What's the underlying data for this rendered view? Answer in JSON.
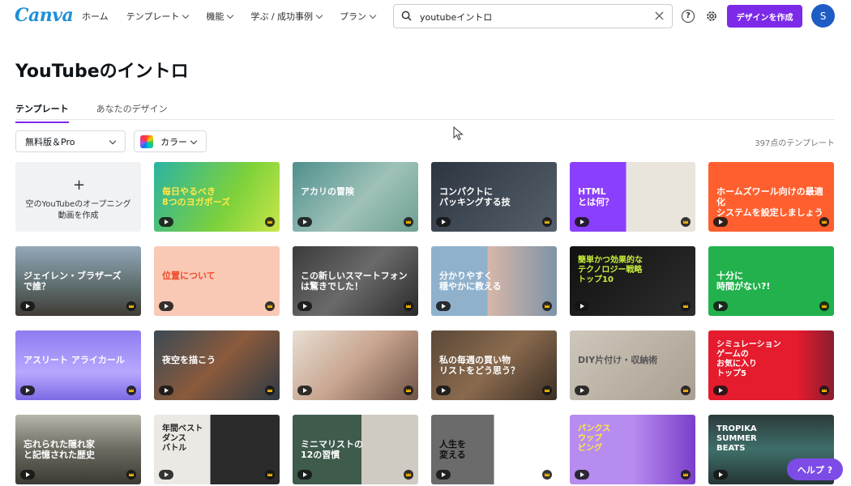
{
  "logo": "Canva",
  "nav": [
    {
      "label": "ホーム",
      "has_menu": false
    },
    {
      "label": "テンプレート",
      "has_menu": true
    },
    {
      "label": "機能",
      "has_menu": true
    },
    {
      "label": "学ぶ / 成功事例",
      "has_menu": true
    },
    {
      "label": "プラン",
      "has_menu": true
    }
  ],
  "search": {
    "value": "youtubeイントロ"
  },
  "header": {
    "create_label": "デザインを作成",
    "avatar_initial": "S"
  },
  "page": {
    "title": "YouTubeのイントロ"
  },
  "tabs": [
    {
      "label": "テンプレート",
      "active": true
    },
    {
      "label": "あなたのデザイン",
      "active": false
    }
  ],
  "filters": {
    "plan": "無料版＆Pro",
    "color": "カラー",
    "count": "397点のテンプレート"
  },
  "create_card": {
    "label": "空のYouTubeのオープニング動画を作成"
  },
  "cards": [
    {
      "text": "毎日やるべき\n8つのヨガポーズ",
      "bg": "linear-gradient(120deg,#2bb3a3,#7dd13a 60%,#c9e64a)",
      "color": "#ffe94a"
    },
    {
      "text": "アカリの冒険",
      "bg": "linear-gradient(135deg,#4e8f8d,#9fc2b8 55%,#6e9f93)",
      "color": "#ffffff"
    },
    {
      "text": "コンパクトに\nパッキングする技",
      "bg": "linear-gradient(135deg,#2c3540,#56606b)",
      "color": "#ffffff"
    },
    {
      "text": "HTML\nとは何？",
      "bg": "linear-gradient(90deg,#8a3ffc 45%,#e9e4dc 45%)",
      "color": "#ffffff"
    },
    {
      "text": "ホームズワール向けの最適化\nシステムを設定しましょう",
      "bg": "#ff5f2e",
      "color": "#ffffff"
    },
    {
      "text": "ジェイレン・ブラザーズ\nで誰？",
      "bg": "linear-gradient(180deg,#93a8b9,#5c6a6a 60%,#403c35)",
      "color": "#ffffff"
    },
    {
      "text": "位置について",
      "bg": "#f9c9b6",
      "color": "#ef4b2a"
    },
    {
      "text": "この新しいスマートフォン\nは驚きでした！",
      "bg": "linear-gradient(135deg,#3b3b3b,#6a6a6a 50%,#2a2a2a)",
      "color": "#ffffff"
    },
    {
      "text": "分かりやすく\n穏やかに教える",
      "bg": "linear-gradient(90deg,#8fb1cc 45%,#d7b7a8 45%,#7d93a8)",
      "color": "#ffffff"
    },
    {
      "text": "簡単かつ効果的な\nテクノロジー戦略\nトップ10",
      "bg": "linear-gradient(135deg,#111111,#2d2d2d)",
      "color": "#c9f03a"
    },
    {
      "text": "十分に\n時間がない?!",
      "bg": "#22b14c",
      "color": "#ffffff"
    },
    {
      "text": "アスリート  アライカール",
      "bg": "linear-gradient(180deg,#8d7cf0,#b9a8ff 60%,#7b69e3)",
      "color": "#ffffff"
    },
    {
      "text": "夜空を描こう",
      "bg": "linear-gradient(135deg,#3a4a55,#8b5a3c 50%,#2e3a44)",
      "color": "#ffffff"
    },
    {
      "text": "",
      "bg": "linear-gradient(135deg,#e8dfd4,#c7a38e 50%,#6e5346)",
      "color": "#ffffff"
    },
    {
      "text": "私の毎週の買い物\nリストをどう思う？",
      "bg": "linear-gradient(135deg,#5a4838,#8a6a4e 50%,#3b2f25)",
      "color": "#ffffff"
    },
    {
      "text": "DIY片付け・収納術",
      "bg": "linear-gradient(135deg,#cfc7bc,#a99f91)",
      "color": "#555555"
    },
    {
      "text": "シミュレーション\nゲームの\nお気に入り\nトップ5",
      "bg": "linear-gradient(90deg,#e51b2e 70%,#8a1d2f)",
      "color": "#ffffff"
    },
    {
      "text": "忘れられた隠れ家\nと記憶された歴史",
      "bg": "linear-gradient(180deg,#b9b6ab,#6b6a60 50%,#3a3a33)",
      "color": "#ffffff"
    },
    {
      "text": "年間ベスト\nダンス\nバトル",
      "bg": "linear-gradient(90deg,#ece9e4 45%,#2b2b2b 45%)",
      "color": "#222222"
    },
    {
      "text": "ミニマリストの\n12の習慣",
      "bg": "linear-gradient(90deg,#3e5b4c 55%,#cfcac2 55%)",
      "color": "#ffffff"
    },
    {
      "text": "人生を\n変える",
      "bg": "linear-gradient(90deg,#6b6b6b 50%,#ffffff 50%)",
      "color": "#111111"
    },
    {
      "text": "パンクス\nウップ\nビング",
      "bg": "linear-gradient(90deg,#b78cf0 50%,#7a3ec9)",
      "color": "#ffeb3b"
    },
    {
      "text": "TROPIKA\nSUMMER\nBEATS",
      "bg": "linear-gradient(180deg,#2b3a3a,#3f6f6a 50%,#243534)",
      "color": "#ffffff"
    }
  ],
  "help": {
    "label": "ヘルプ ?"
  }
}
